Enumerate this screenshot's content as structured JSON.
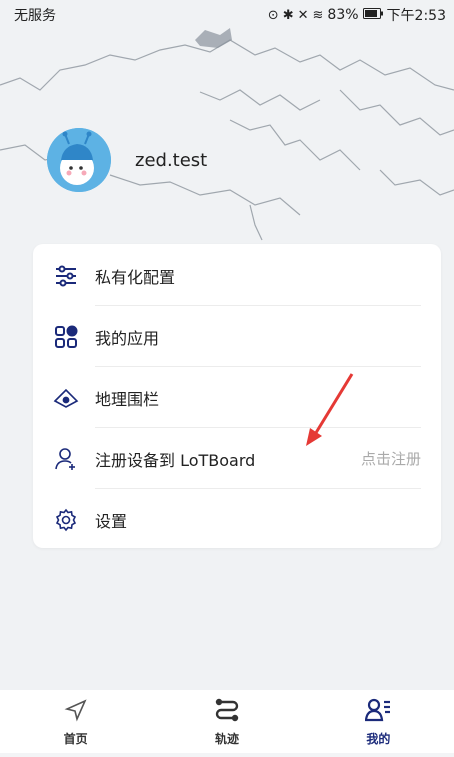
{
  "status_bar": {
    "carrier": "无服务",
    "battery": "83%",
    "time": "下午2:53"
  },
  "profile": {
    "username": "zed.test"
  },
  "menu": [
    {
      "label": "私有化配置",
      "icon": "sliders-icon",
      "action": ""
    },
    {
      "label": "我的应用",
      "icon": "apps-grid-icon",
      "action": ""
    },
    {
      "label": "地理围栏",
      "icon": "geofence-icon",
      "action": ""
    },
    {
      "label": "注册设备到 LoTBoard",
      "icon": "add-user-icon",
      "action": "点击注册"
    },
    {
      "label": "设置",
      "icon": "gear-icon",
      "action": ""
    }
  ],
  "tabs": [
    {
      "label": "首页",
      "icon": "navigation-arrow-icon",
      "active": false
    },
    {
      "label": "轨迹",
      "icon": "track-route-icon",
      "active": false
    },
    {
      "label": "我的",
      "icon": "profile-icon",
      "active": true
    }
  ],
  "colors": {
    "active_tab": "#1b2a7a",
    "annotation_arrow": "#e53935"
  }
}
